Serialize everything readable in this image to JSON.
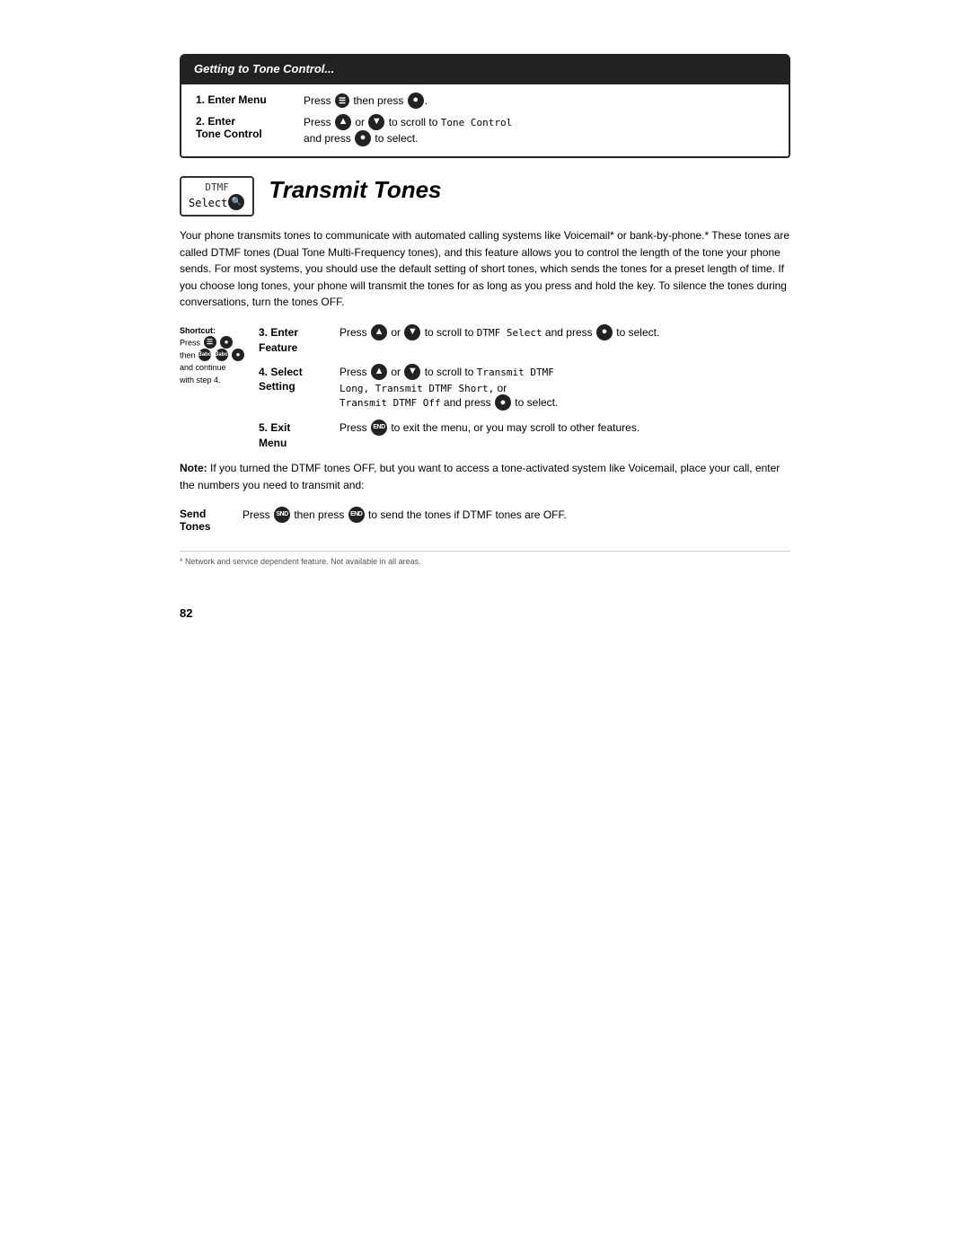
{
  "page": {
    "number": "82",
    "getting_box": {
      "title": "Getting to Tone Control...",
      "steps": [
        {
          "number": "1.",
          "label": "Enter Menu",
          "desc_text": "then press",
          "desc_prefix": "Press"
        },
        {
          "number": "2.",
          "label": "Enter",
          "sublabel": "Tone Control",
          "desc_text": "or",
          "desc_prefix": "Press",
          "desc_scroll": "to scroll to",
          "desc_code": "Tone Control",
          "desc_and": "and press",
          "desc_select": "to select."
        }
      ]
    },
    "section": {
      "title": "Transmit Tones",
      "dtmf_label": "DTMF",
      "dtmf_select": "Select",
      "body": "Your phone transmits tones to communicate with automated calling systems like Voicemail* or bank-by-phone.* These tones are called DTMF tones (Dual Tone Multi-Frequency tones), and this feature allows you to control the length of the tone your phone sends. For most systems, you should use the default setting of short tones, which sends the tones for a preset length of time. If you choose long tones, your phone will transmit the tones for as long as you press and hold the key. To silence the tones during conversations, turn the tones OFF.",
      "shortcut": {
        "label": "Shortcut:",
        "line1": "Press",
        "line2": "then",
        "line3": "and continue",
        "line4": "with step 4."
      },
      "steps": [
        {
          "number": "3.",
          "label": "Enter",
          "sublabel": "Feature",
          "desc": "to scroll to",
          "code": "DTMF Select",
          "desc2": "and press",
          "desc3": "to select."
        },
        {
          "number": "4.",
          "label": "Select",
          "sublabel": "Setting",
          "desc": "to scroll to",
          "code1": "Transmit DTMF Long,",
          "code2": "Transmit DTMF Short,",
          "code3": "or",
          "code4": "Transmit DTMF Off",
          "desc2": "and press",
          "desc3": "to select."
        },
        {
          "number": "5.",
          "label": "Exit",
          "sublabel": "Menu",
          "desc": "to exit the menu, or you may scroll to other features.",
          "desc_prefix": "Press"
        }
      ],
      "note": "Note: If you turned the DTMF tones OFF, but you want to access a tone-activated system like Voicemail, place your call, enter the numbers you need to transmit and:",
      "send": {
        "label": "Send",
        "sublabel": "Tones",
        "desc": "then press",
        "desc2": "to send the tones if DTMF tones are OFF.",
        "desc_prefix": "Press"
      },
      "footnote": "* Network and service dependent feature. Not available in all areas."
    }
  }
}
